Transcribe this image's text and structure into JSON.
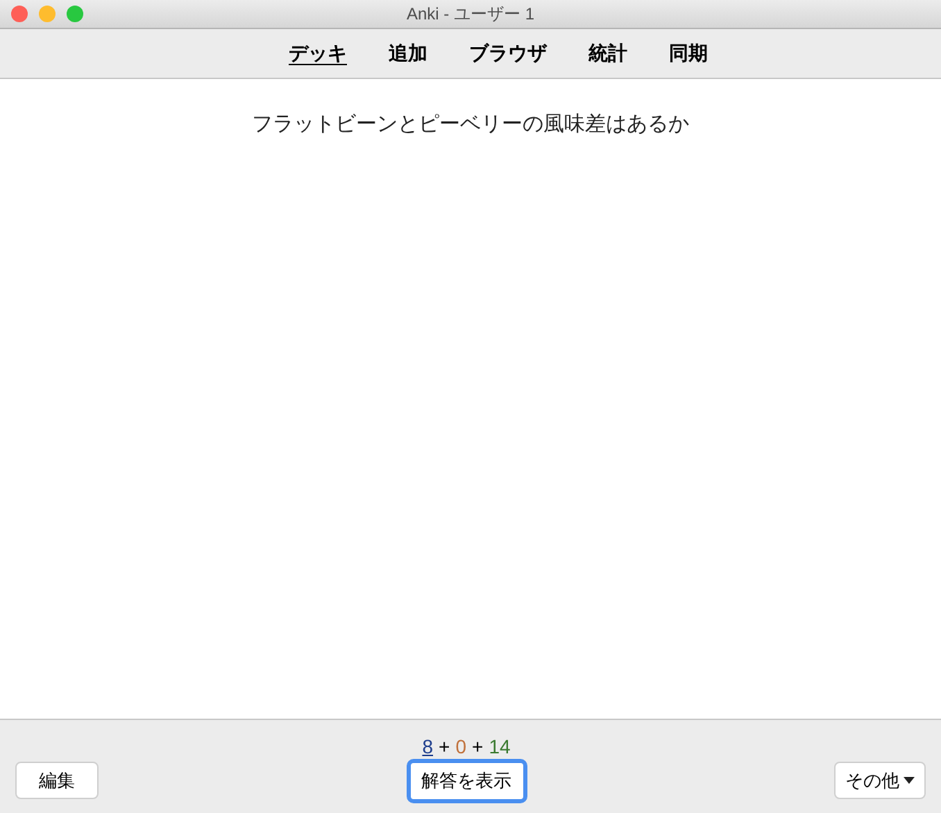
{
  "window": {
    "title": "Anki - ユーザー 1"
  },
  "tabs": [
    {
      "label": "デッキ",
      "selected": true
    },
    {
      "label": "追加",
      "selected": false
    },
    {
      "label": "ブラウザ",
      "selected": false
    },
    {
      "label": "統計",
      "selected": false
    },
    {
      "label": "同期",
      "selected": false
    }
  ],
  "question": "フラットビーンとピーベリーの風味差はあるか",
  "counts": [
    {
      "value": "8",
      "color": "#1c3c8c",
      "selected": true
    },
    {
      "value": "0",
      "color": "#c0703a",
      "selected": false
    },
    {
      "value": "14",
      "color": "#3a7a30",
      "selected": false
    }
  ],
  "count_separator": "+",
  "buttons": {
    "edit": "編集",
    "show_answer": "解答を表示",
    "more": "その他"
  }
}
